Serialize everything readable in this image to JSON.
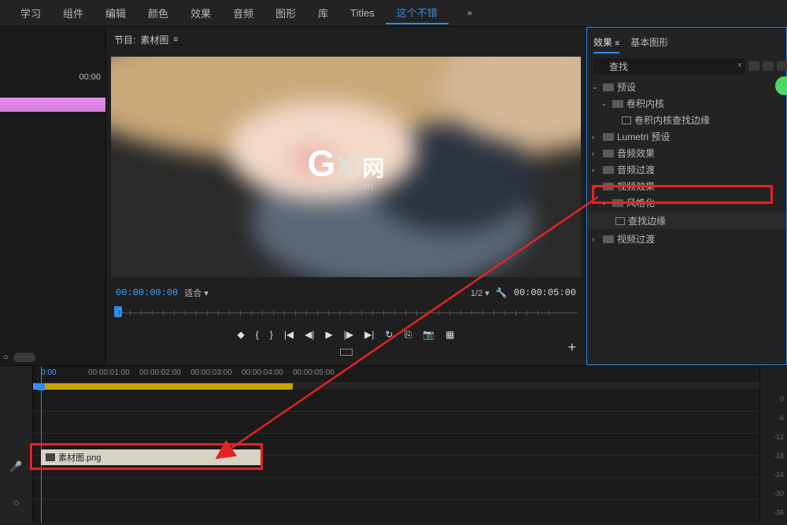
{
  "menu": {
    "items": [
      "学习",
      "组件",
      "编辑",
      "颜色",
      "效果",
      "音频",
      "图形",
      "库",
      "Titles",
      "这个不错"
    ],
    "active_index": 9,
    "chevron": "»"
  },
  "left": {
    "timecode": "00:00"
  },
  "preview": {
    "title_prefix": "节目:",
    "title_name": "素材图",
    "menu_icon": "≡",
    "watermark_g": "G",
    "watermark_xi": "XI",
    "watermark_wang": "网",
    "watermark_sub": "system.com",
    "current_time": "00:00:00:00",
    "fit": "适合",
    "fit_chev": "▾",
    "zoom": "1/2",
    "zoom_chev": "▾",
    "duration": "00:00:05:00",
    "transport": {
      "mark_in": "◆",
      "brace_l": "{",
      "brace_r": "}",
      "prev": "|◀",
      "step_b": "◀|",
      "play": "▶",
      "step_f": "|▶",
      "next": "▶|",
      "loop": "↻",
      "export": "⎘",
      "camera": "📷",
      "safe": "▦"
    },
    "add": "+"
  },
  "effects": {
    "tabs": [
      "效果",
      "基本图形"
    ],
    "active_tab": 0,
    "tab_icon": "≡",
    "search_value": "查找",
    "search_icon": "🔍",
    "clear": "×",
    "tree": {
      "presets": "预设",
      "conv": "卷积内核",
      "conv_edge": "卷积内核查找边缘",
      "lumetri": "Lumetri 预设",
      "audio_fx": "音频效果",
      "audio_tr": "音频过渡",
      "video_fx": "视频效果",
      "stylize": "风格化",
      "find_edges": "查找边缘",
      "video_tr": "视频过渡"
    },
    "arrow_down": "⌄",
    "arrow_right": "›"
  },
  "timeline": {
    "ruler": [
      "0:00",
      "00:00:01:00",
      "00:00:02:00",
      "00:00:03:00",
      "00:00:04:00",
      "00:00:05:00"
    ],
    "clip_name": "素材图.png",
    "mic": "🎤",
    "lock": "○",
    "db": [
      "0",
      "-6",
      "-12",
      "-18",
      "-24",
      "-30",
      "-36"
    ]
  }
}
